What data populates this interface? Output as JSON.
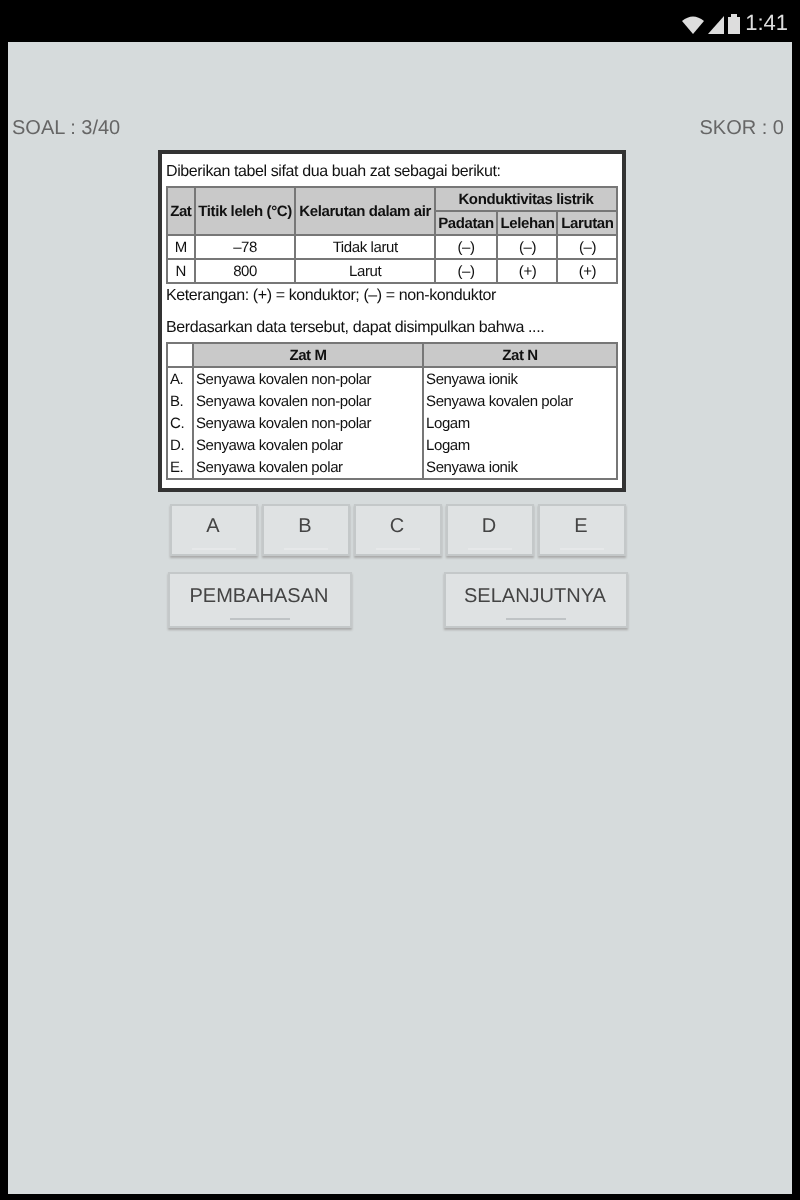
{
  "status_bar": {
    "time": "1:41"
  },
  "header": {
    "question_counter": "SOAL : 3/40",
    "score": "SKOR : 0"
  },
  "question": {
    "intro": "Diberikan tabel sifat dua buah zat sebagai berikut:",
    "data_table": {
      "columns": [
        "Zat",
        "Titik leleh (°C)",
        "Kelarutan dalam air"
      ],
      "group_column": "Konduktivitas listrik",
      "sub_columns": [
        "Padatan",
        "Lelehan",
        "Larutan"
      ],
      "rows": [
        [
          "M",
          "–78",
          "Tidak larut",
          "(–)",
          "(–)",
          "(–)"
        ],
        [
          "N",
          "800",
          "Larut",
          "(–)",
          "(+)",
          "(+)"
        ]
      ]
    },
    "note": "Keterangan: (+) = konduktor; (–) = non-konduktor",
    "prompt": "Berdasarkan data tersebut, dapat disimpulkan bahwa ....",
    "options_table": {
      "columns": [
        "Zat M",
        "Zat N"
      ],
      "rows": [
        {
          "letter": "A.",
          "m": "Senyawa kovalen non-polar",
          "n": "Senyawa ionik"
        },
        {
          "letter": "B.",
          "m": "Senyawa kovalen non-polar",
          "n": "Senyawa kovalen polar"
        },
        {
          "letter": "C.",
          "m": "Senyawa kovalen non-polar",
          "n": "Logam"
        },
        {
          "letter": "D.",
          "m": "Senyawa kovalen polar",
          "n": "Logam"
        },
        {
          "letter": "E.",
          "m": "Senyawa kovalen polar",
          "n": "Senyawa ionik"
        }
      ]
    }
  },
  "answers": [
    "A",
    "B",
    "C",
    "D",
    "E"
  ],
  "buttons": [
    "PEMBAHASAN",
    "SELANJUTNYA"
  ]
}
